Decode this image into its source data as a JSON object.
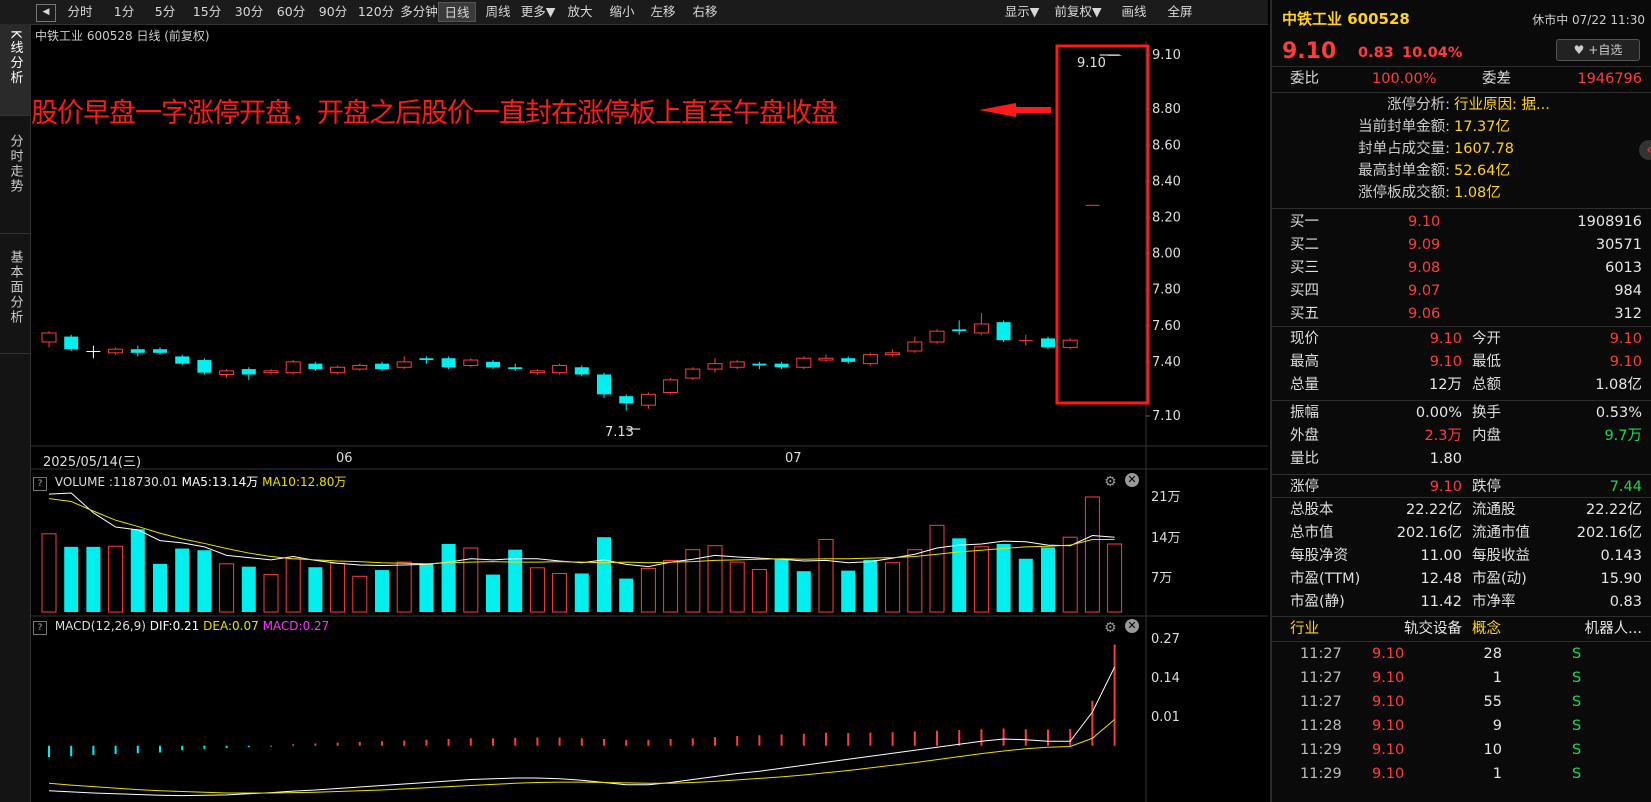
{
  "toolbar": {
    "back": "◀",
    "items": [
      "分时",
      "1分",
      "5分",
      "15分",
      "30分",
      "60分",
      "90分",
      "120分",
      "多分钟",
      "日线",
      "周线",
      "更多▼",
      "放大",
      "缩小",
      "左移",
      "右移"
    ],
    "active": "日线",
    "right_items": [
      "显示▼",
      "前复权▼",
      "画线",
      "全屏"
    ]
  },
  "left_tabs": [
    {
      "label": "K线分析"
    },
    {
      "label": "分时走势"
    },
    {
      "label": "基本面分析"
    }
  ],
  "chart": {
    "header": "中铁工业 600528 日线 (前复权)",
    "annotation": "股价早盘一字涨停开盘，开盘之后股价一直封在涨停板上直至午盘收盘",
    "high_label": "9.10",
    "low_label": "7.13",
    "date_labels": [
      "2025/05/14(三)",
      "06",
      "07"
    ],
    "y_ticks": [
      "9.10",
      "8.80",
      "8.60",
      "8.40",
      "8.20",
      "8.00",
      "7.80",
      "7.60",
      "7.40",
      "7.10"
    ],
    "volume_header": {
      "prefix": "VOLUME",
      "value": ":118730.01",
      "ma5": "MA5:13.14万",
      "ma10": "MA10:12.80万"
    },
    "volume_ticks": [
      "21万",
      "14万",
      "7万"
    ],
    "macd_header": {
      "prefix": "MACD(12,26,9)",
      "dif": "DIF:0.21",
      "dea": "DEA:0.07",
      "macd": "MACD:0.27"
    },
    "macd_ticks": [
      "0.27",
      "0.14",
      "0.01"
    ],
    "colors": {
      "up": "#ff3b3b",
      "down": "#00f0f0",
      "ma5": "#ffffff",
      "ma10": "#e8e000",
      "dif": "#ffffff",
      "dea": "#e8e000"
    }
  },
  "chart_data": {
    "type": "candlestick",
    "ylim": [
      7.1,
      9.1
    ],
    "candles": [
      {
        "o": 7.51,
        "c": 7.56,
        "h": 7.57,
        "l": 7.48
      },
      {
        "o": 7.54,
        "c": 7.47,
        "h": 7.55,
        "l": 7.46
      },
      {
        "o": 7.46,
        "c": 7.46,
        "h": 7.49,
        "l": 7.42
      },
      {
        "o": 7.45,
        "c": 7.47,
        "h": 7.48,
        "l": 7.44
      },
      {
        "o": 7.47,
        "c": 7.45,
        "h": 7.49,
        "l": 7.43
      },
      {
        "o": 7.47,
        "c": 7.45,
        "h": 7.48,
        "l": 7.44
      },
      {
        "o": 7.43,
        "c": 7.39,
        "h": 7.44,
        "l": 7.38
      },
      {
        "o": 7.41,
        "c": 7.34,
        "h": 7.42,
        "l": 7.33
      },
      {
        "o": 7.33,
        "c": 7.35,
        "h": 7.36,
        "l": 7.31
      },
      {
        "o": 7.36,
        "c": 7.33,
        "h": 7.37,
        "l": 7.3
      },
      {
        "o": 7.34,
        "c": 7.35,
        "h": 7.36,
        "l": 7.33
      },
      {
        "o": 7.34,
        "c": 7.4,
        "h": 7.41,
        "l": 7.33
      },
      {
        "o": 7.39,
        "c": 7.36,
        "h": 7.4,
        "l": 7.35
      },
      {
        "o": 7.34,
        "c": 7.37,
        "h": 7.38,
        "l": 7.33
      },
      {
        "o": 7.36,
        "c": 7.38,
        "h": 7.39,
        "l": 7.35
      },
      {
        "o": 7.39,
        "c": 7.36,
        "h": 7.4,
        "l": 7.35
      },
      {
        "o": 7.37,
        "c": 7.4,
        "h": 7.43,
        "l": 7.36
      },
      {
        "o": 7.42,
        "c": 7.41,
        "h": 7.43,
        "l": 7.39
      },
      {
        "o": 7.42,
        "c": 7.37,
        "h": 7.43,
        "l": 7.36
      },
      {
        "o": 7.38,
        "c": 7.41,
        "h": 7.42,
        "l": 7.37
      },
      {
        "o": 7.4,
        "c": 7.37,
        "h": 7.41,
        "l": 7.36
      },
      {
        "o": 7.37,
        "c": 7.36,
        "h": 7.39,
        "l": 7.35
      },
      {
        "o": 7.34,
        "c": 7.35,
        "h": 7.36,
        "l": 7.33
      },
      {
        "o": 7.34,
        "c": 7.38,
        "h": 7.39,
        "l": 7.33
      },
      {
        "o": 7.37,
        "c": 7.33,
        "h": 7.38,
        "l": 7.32
      },
      {
        "o": 7.33,
        "c": 7.22,
        "h": 7.34,
        "l": 7.2
      },
      {
        "o": 7.21,
        "c": 7.17,
        "h": 7.22,
        "l": 7.13
      },
      {
        "o": 7.16,
        "c": 7.22,
        "h": 7.23,
        "l": 7.14
      },
      {
        "o": 7.23,
        "c": 7.3,
        "h": 7.31,
        "l": 7.22
      },
      {
        "o": 7.31,
        "c": 7.36,
        "h": 7.37,
        "l": 7.3
      },
      {
        "o": 7.36,
        "c": 7.39,
        "h": 7.42,
        "l": 7.34
      },
      {
        "o": 7.37,
        "c": 7.4,
        "h": 7.41,
        "l": 7.36
      },
      {
        "o": 7.39,
        "c": 7.38,
        "h": 7.4,
        "l": 7.36
      },
      {
        "o": 7.39,
        "c": 7.37,
        "h": 7.4,
        "l": 7.36
      },
      {
        "o": 7.37,
        "c": 7.42,
        "h": 7.43,
        "l": 7.36
      },
      {
        "o": 7.41,
        "c": 7.42,
        "h": 7.44,
        "l": 7.4
      },
      {
        "o": 7.42,
        "c": 7.4,
        "h": 7.43,
        "l": 7.39
      },
      {
        "o": 7.39,
        "c": 7.44,
        "h": 7.45,
        "l": 7.38
      },
      {
        "o": 7.44,
        "c": 7.45,
        "h": 7.47,
        "l": 7.43
      },
      {
        "o": 7.46,
        "c": 7.51,
        "h": 7.54,
        "l": 7.45
      },
      {
        "o": 7.51,
        "c": 7.57,
        "h": 7.58,
        "l": 7.5
      },
      {
        "o": 7.58,
        "c": 7.57,
        "h": 7.63,
        "l": 7.55
      },
      {
        "o": 7.56,
        "c": 7.61,
        "h": 7.67,
        "l": 7.55
      },
      {
        "o": 7.62,
        "c": 7.52,
        "h": 7.63,
        "l": 7.51
      },
      {
        "o": 7.52,
        "c": 7.52,
        "h": 7.55,
        "l": 7.49
      },
      {
        "o": 7.53,
        "c": 7.48,
        "h": 7.54,
        "l": 7.47
      },
      {
        "o": 7.48,
        "c": 7.52,
        "h": 7.53,
        "l": 7.47
      },
      {
        "o": 8.27,
        "c": 8.27,
        "h": 8.27,
        "l": 8.27
      },
      {
        "o": 9.1,
        "c": 9.1,
        "h": 9.1,
        "l": 9.1
      }
    ],
    "volume": [
      {
        "v": 13.8,
        "up": true
      },
      {
        "v": 11.5,
        "up": false
      },
      {
        "v": 11.5,
        "up": false
      },
      {
        "v": 11.6,
        "up": true
      },
      {
        "v": 14.6,
        "up": false
      },
      {
        "v": 8.5,
        "up": false
      },
      {
        "v": 11.2,
        "up": false
      },
      {
        "v": 10.9,
        "up": false
      },
      {
        "v": 8.5,
        "up": true
      },
      {
        "v": 8.0,
        "up": false
      },
      {
        "v": 6.6,
        "up": true
      },
      {
        "v": 9.4,
        "up": true
      },
      {
        "v": 7.9,
        "up": false
      },
      {
        "v": 8.6,
        "up": true
      },
      {
        "v": 6.3,
        "up": true
      },
      {
        "v": 7.4,
        "up": false
      },
      {
        "v": 8.8,
        "up": true
      },
      {
        "v": 8.6,
        "up": false
      },
      {
        "v": 12.0,
        "up": false
      },
      {
        "v": 11.3,
        "up": true
      },
      {
        "v": 6.6,
        "up": false
      },
      {
        "v": 11.0,
        "up": false
      },
      {
        "v": 7.8,
        "up": true
      },
      {
        "v": 6.8,
        "up": true
      },
      {
        "v": 6.8,
        "up": false
      },
      {
        "v": 13.2,
        "up": false
      },
      {
        "v": 5.9,
        "up": false
      },
      {
        "v": 7.7,
        "up": true
      },
      {
        "v": 9.1,
        "up": true
      },
      {
        "v": 11.0,
        "up": true
      },
      {
        "v": 11.7,
        "up": true
      },
      {
        "v": 8.8,
        "up": true
      },
      {
        "v": 7.5,
        "up": true
      },
      {
        "v": 9.3,
        "up": false
      },
      {
        "v": 7.2,
        "up": false
      },
      {
        "v": 12.8,
        "up": true
      },
      {
        "v": 7.3,
        "up": false
      },
      {
        "v": 9.2,
        "up": false
      },
      {
        "v": 8.7,
        "up": true
      },
      {
        "v": 11.0,
        "up": true
      },
      {
        "v": 15.3,
        "up": true
      },
      {
        "v": 13.0,
        "up": false
      },
      {
        "v": 11.5,
        "up": true
      },
      {
        "v": 12.0,
        "up": false
      },
      {
        "v": 9.4,
        "up": false
      },
      {
        "v": 11.4,
        "up": false
      },
      {
        "v": 13.2,
        "up": true
      },
      {
        "v": 20.3,
        "up": true
      },
      {
        "v": 12.0,
        "up": true
      }
    ],
    "ma5": [
      20.8,
      21.0,
      17.5,
      15.0,
      14.5,
      12.6,
      12.2,
      11.5,
      10.0,
      9.6,
      9.2,
      9.8,
      9.1,
      8.6,
      8.3,
      8.2,
      8.3,
      8.4,
      8.8,
      9.4,
      9.2,
      9.4,
      9.4,
      9.0,
      8.7,
      9.2,
      8.4,
      8.0,
      8.8,
      9.3,
      10.0,
      9.7,
      9.5,
      9.3,
      9.0,
      9.1,
      8.7,
      8.9,
      9.5,
      10.2,
      11.3,
      11.8,
      12.0,
      12.5,
      12.4,
      11.8,
      11.7,
      13.5,
      13.2
    ],
    "ma10": [
      20.0,
      19.5,
      17.8,
      16.2,
      15.1,
      13.9,
      12.9,
      12.1,
      11.2,
      10.4,
      9.8,
      9.4,
      9.2,
      9.0,
      8.9,
      8.7,
      8.6,
      8.5,
      8.7,
      8.8,
      8.9,
      8.8,
      8.8,
      8.9,
      8.8,
      8.7,
      8.8,
      8.7,
      8.8,
      8.9,
      9.1,
      9.2,
      9.3,
      9.4,
      9.3,
      9.4,
      9.4,
      9.5,
      9.6,
      9.8,
      10.2,
      10.6,
      10.9,
      11.2,
      11.5,
      11.6,
      11.8,
      12.8,
      12.8
    ],
    "macd": [
      -0.03,
      -0.028,
      -0.025,
      -0.022,
      -0.02,
      -0.018,
      -0.012,
      -0.008,
      -0.006,
      -0.004,
      -0.002,
      0.004,
      0.006,
      0.008,
      0.01,
      0.012,
      0.014,
      0.016,
      0.018,
      0.02,
      0.02,
      0.021,
      0.022,
      0.022,
      0.02,
      0.018,
      0.015,
      0.016,
      0.018,
      0.02,
      0.023,
      0.026,
      0.028,
      0.03,
      0.032,
      0.035,
      0.034,
      0.035,
      0.036,
      0.038,
      0.04,
      0.042,
      0.044,
      0.046,
      0.044,
      0.043,
      0.045,
      0.12,
      0.27
    ],
    "dif": [
      -0.12,
      -0.123,
      -0.126,
      -0.128,
      -0.13,
      -0.132,
      -0.133,
      -0.132,
      -0.131,
      -0.128,
      -0.125,
      -0.121,
      -0.118,
      -0.114,
      -0.11,
      -0.106,
      -0.102,
      -0.098,
      -0.094,
      -0.09,
      -0.088,
      -0.086,
      -0.086,
      -0.088,
      -0.092,
      -0.098,
      -0.104,
      -0.104,
      -0.098,
      -0.09,
      -0.082,
      -0.074,
      -0.068,
      -0.06,
      -0.052,
      -0.044,
      -0.036,
      -0.028,
      -0.02,
      -0.012,
      -0.004,
      0.004,
      0.012,
      0.018,
      0.016,
      0.012,
      0.012,
      0.09,
      0.21
    ],
    "dea": [
      -0.1,
      -0.105,
      -0.109,
      -0.113,
      -0.117,
      -0.12,
      -0.122,
      -0.124,
      -0.126,
      -0.126,
      -0.126,
      -0.125,
      -0.124,
      -0.122,
      -0.12,
      -0.118,
      -0.115,
      -0.112,
      -0.109,
      -0.106,
      -0.103,
      -0.1,
      -0.098,
      -0.097,
      -0.097,
      -0.098,
      -0.099,
      -0.1,
      -0.1,
      -0.098,
      -0.095,
      -0.091,
      -0.087,
      -0.083,
      -0.078,
      -0.072,
      -0.066,
      -0.059,
      -0.052,
      -0.045,
      -0.037,
      -0.029,
      -0.021,
      -0.014,
      -0.008,
      -0.004,
      -0.002,
      0.02,
      0.07
    ],
    "vol_max": 21,
    "macd_range": [
      -0.15,
      0.29
    ]
  },
  "panel": {
    "name_code": "中铁工业 600528",
    "status_time": "休市中 07/22 11:30",
    "price": "9.10",
    "change": "0.83",
    "pct": "10.04%",
    "fav_button": "+自选",
    "webi_label": "委比",
    "webi_value": "100.00%",
    "weicha_label": "委差",
    "weicha_value": "1946796",
    "limit_rows": [
      {
        "label": "涨停分析:",
        "value": "行业原因: 据..."
      },
      {
        "label": "当前封单金额:",
        "value": "17.37亿"
      },
      {
        "label": "封单占成交量:",
        "value": "1607.78"
      },
      {
        "label": "最高封单金额:",
        "value": "52.64亿"
      },
      {
        "label": "涨停板成交额:",
        "value": "1.08亿"
      }
    ],
    "bids": [
      {
        "label": "买一",
        "price": "9.10",
        "vol": "1908916"
      },
      {
        "label": "买二",
        "price": "9.09",
        "vol": "30571"
      },
      {
        "label": "买三",
        "price": "9.08",
        "vol": "6013"
      },
      {
        "label": "买四",
        "price": "9.07",
        "vol": "984"
      },
      {
        "label": "买五",
        "price": "9.06",
        "vol": "312"
      }
    ],
    "quote_rows": [
      {
        "l1": "现价",
        "v1": "9.10",
        "c1": "red",
        "l2": "今开",
        "v2": "9.10",
        "c2": "red"
      },
      {
        "l1": "最高",
        "v1": "9.10",
        "c1": "red",
        "l2": "最低",
        "v2": "9.10",
        "c2": "red"
      },
      {
        "l1": "总量",
        "v1": "12万",
        "c1": "wht",
        "l2": "总额",
        "v2": "1.08亿",
        "c2": "wht"
      }
    ],
    "stat_rows": [
      {
        "l1": "振幅",
        "v1": "0.00%",
        "c1": "wht",
        "l2": "换手",
        "v2": "0.53%",
        "c2": "wht"
      },
      {
        "l1": "外盘",
        "v1": "2.3万",
        "c1": "red",
        "l2": "内盘",
        "v2": "9.7万",
        "c2": "grn"
      },
      {
        "l1": "量比",
        "v1": "1.80",
        "c1": "wht",
        "l2": "",
        "v2": "",
        "c2": "wht"
      }
    ],
    "limit_price_row": {
      "l1": "涨停",
      "v1": "9.10",
      "l2": "跌停",
      "v2": "7.44"
    },
    "fund_rows": [
      {
        "l1": "总股本",
        "v1": "22.22亿",
        "l2": "流通股",
        "v2": "22.22亿"
      },
      {
        "l1": "总市值",
        "v1": "202.16亿",
        "l2": "流通市值",
        "v2": "202.16亿"
      },
      {
        "l1": "每股净资",
        "v1": "11.00",
        "l2": "每股收益",
        "v2": "0.143"
      },
      {
        "l1": "市盈(TTM)",
        "v1": "12.48",
        "l2": "市盈(动)",
        "v2": "15.90"
      },
      {
        "l1": "市盈(静)",
        "v1": "11.42",
        "l2": "市净率",
        "v2": "0.83"
      }
    ],
    "industry_row": {
      "l1": "行业",
      "v1": "轨交设备",
      "l2": "概念",
      "v2": "机器人..."
    },
    "ticks": [
      {
        "time": "11:27",
        "price": "9.10",
        "vol": "28",
        "side": "S"
      },
      {
        "time": "11:27",
        "price": "9.10",
        "vol": "1",
        "side": "S"
      },
      {
        "time": "11:27",
        "price": "9.10",
        "vol": "55",
        "side": "S"
      },
      {
        "time": "11:28",
        "price": "9.10",
        "vol": "9",
        "side": "S"
      },
      {
        "time": "11:29",
        "price": "9.10",
        "vol": "10",
        "side": "S"
      },
      {
        "time": "11:29",
        "price": "9.10",
        "vol": "1",
        "side": "S"
      }
    ]
  }
}
